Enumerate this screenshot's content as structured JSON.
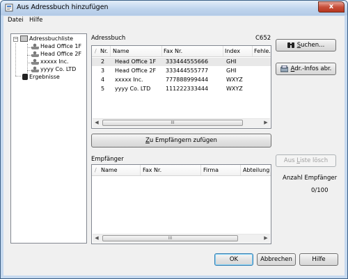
{
  "window": {
    "title": "Aus Adressbuch hinzufügen",
    "close": "x"
  },
  "menu": [
    "Datei",
    "Hilfe"
  ],
  "tree": {
    "root": "Adressbuchliste",
    "children": [
      "Head Office 1F",
      "Head Office 2F",
      "xxxxx Inc.",
      "yyyy Co. LTD"
    ],
    "results": "Ergebnisse"
  },
  "addressbook": {
    "label": "Adressbuch",
    "model": "C652",
    "columns": [
      "Nr.",
      "Name",
      "Fax Nr.",
      "Index",
      "Fehle."
    ],
    "rows": [
      {
        "nr": "2",
        "name": "Head Office 1F",
        "fax": "333444555666",
        "index": "GHI"
      },
      {
        "nr": "3",
        "name": "Head Office 2F",
        "fax": "333444555777",
        "index": "GHI"
      },
      {
        "nr": "4",
        "name": "xxxxx Inc.",
        "fax": "777888999444",
        "index": "WXYZ"
      },
      {
        "nr": "5",
        "name": "yyyy Co. LTD",
        "fax": "111222333444",
        "index": "WXYZ"
      }
    ],
    "scroll_thumb": "III"
  },
  "buttons": {
    "search_u": "S",
    "search_rest": "uchen...",
    "addr_info_u": "A",
    "addr_info_rest": "dr.-Infos abr.",
    "add_recipients_u": "Z",
    "add_recipients_rest": "u Empfängern zufügen",
    "remove_pre": "Aus ",
    "remove_u": "L",
    "remove_rest": "iste lösch",
    "ok": "OK",
    "cancel": "Abbrechen",
    "help": "Hilfe"
  },
  "recipients": {
    "label": "Empfänger",
    "columns": [
      "Name",
      "Fax Nr.",
      "Firma",
      "Abteilung"
    ],
    "scroll_thumb": "III",
    "count_label": "Anzahl Empfänger",
    "count_value": "0/100"
  }
}
